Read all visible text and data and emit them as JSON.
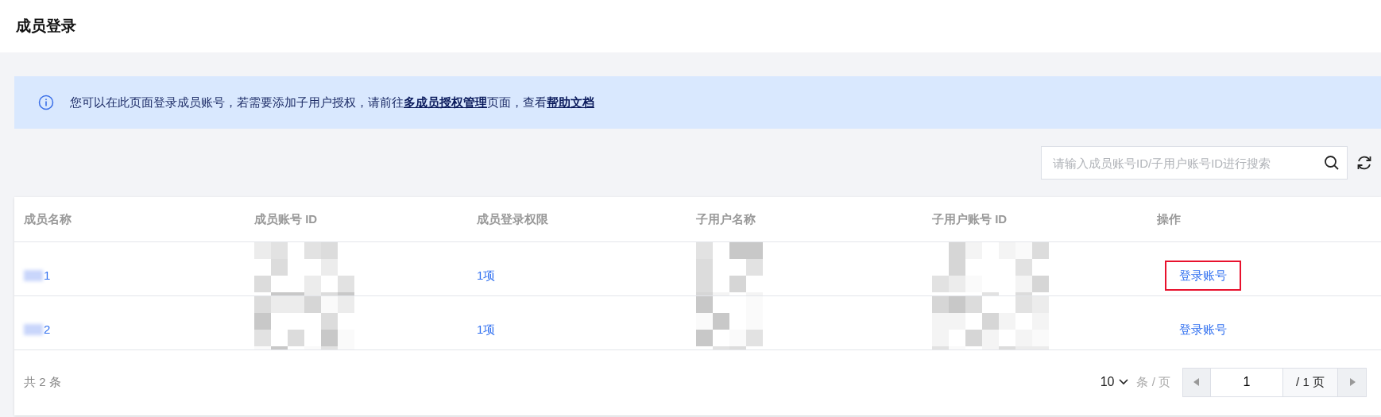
{
  "page_title": "成员登录",
  "notice": {
    "text": "您可以在此页面登录成员账号，若需要添加子用户授权，请前往",
    "link1": "多成员授权管理",
    "middle": "页面，查看",
    "link2": "帮助文档"
  },
  "search": {
    "placeholder": "请输入成员账号ID/子用户账号ID进行搜索"
  },
  "table": {
    "columns": [
      "成员名称",
      "成员账号 ID",
      "成员登录权限",
      "子用户名称",
      "子用户账号 ID",
      "操作"
    ],
    "rows": [
      {
        "member_name": "1",
        "permission": "1项",
        "action": "登录账号",
        "highlighted": true
      },
      {
        "member_name": "2",
        "permission": "1项",
        "action": "登录账号",
        "highlighted": false
      }
    ]
  },
  "footer": {
    "total": "共 2 条",
    "page_size": "10",
    "page_size_unit": "条 / 页",
    "current_page": "1",
    "page_count": "/ 1 页"
  }
}
